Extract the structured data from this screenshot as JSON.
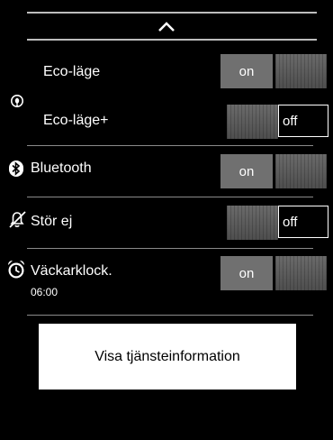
{
  "settings": {
    "eco_mode": {
      "label": "Eco-läge",
      "state": "on"
    },
    "eco_mode_plus": {
      "label": "Eco-läge+",
      "state": "off"
    },
    "bluetooth": {
      "label": "Bluetooth",
      "state": "on"
    },
    "do_not_disturb": {
      "label": "Stör ej",
      "state": "off"
    },
    "alarm_clock": {
      "label": "Väckarklock.",
      "time": "06:00",
      "state": "on"
    }
  },
  "actions": {
    "service_info_label": "Visa tjänsteinformation"
  },
  "icons": {
    "collapse": "chevron-up-icon",
    "eco": "eco-icon",
    "bluetooth": "bluetooth-icon",
    "dnd": "bell-off-icon",
    "alarm": "alarm-clock-icon"
  }
}
